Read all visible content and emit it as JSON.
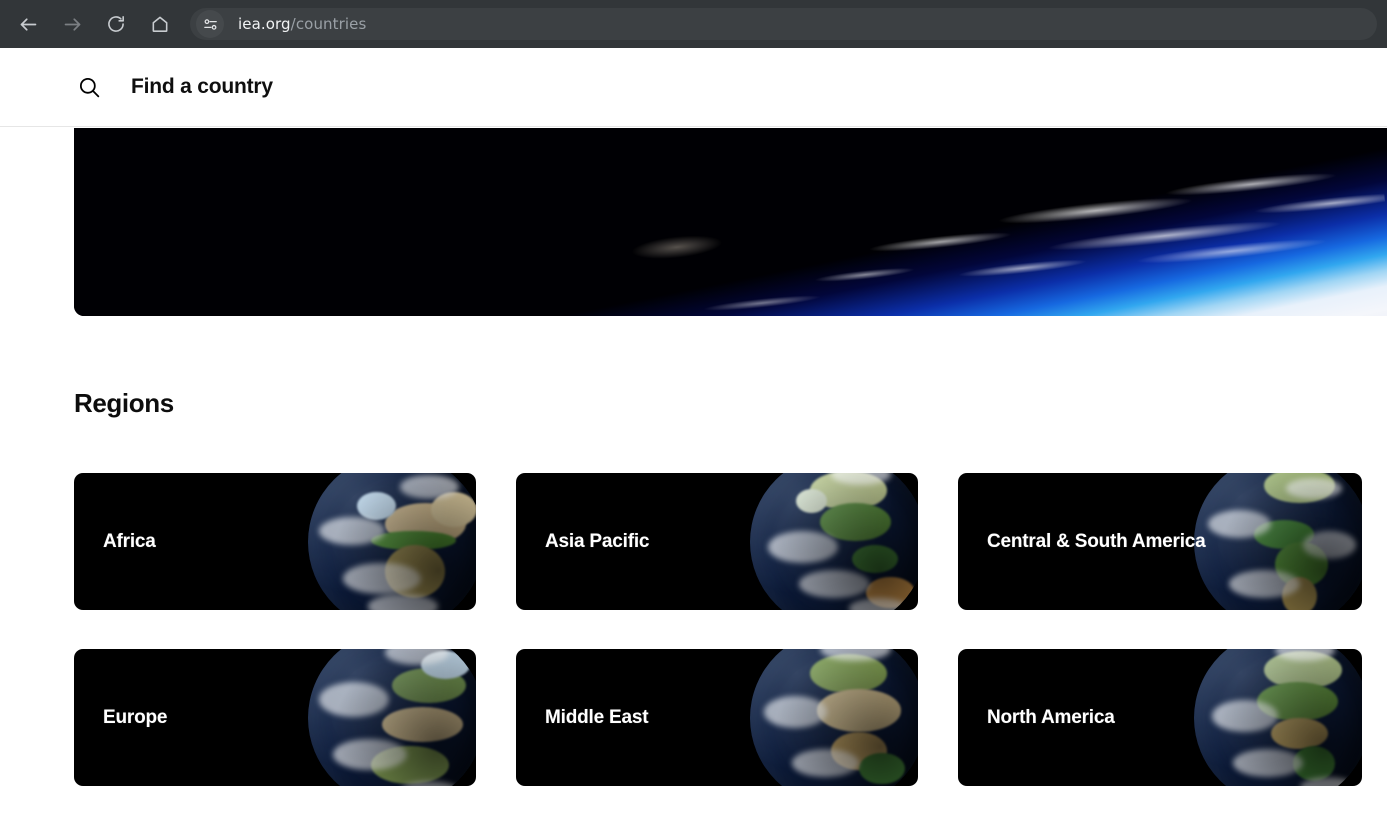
{
  "browser": {
    "back_icon": "arrow-left-icon",
    "forward_icon": "arrow-right-icon",
    "reload_icon": "reload-icon",
    "home_icon": "home-icon",
    "site_settings_icon": "tune-sliders-icon",
    "url_host": "iea.org",
    "url_path": "/countries",
    "chrome_bg": "#323639",
    "omnibox_bg": "#3c4043"
  },
  "search": {
    "icon": "search-icon",
    "label": "Find a country",
    "placeholder": "Find a country"
  },
  "hero": {
    "alt": "Earth horizon seen from space",
    "image_name": "earth-limb-banner"
  },
  "main": {
    "section_title": "Regions",
    "regions": [
      {
        "label": "Africa",
        "globe": "globe-africa-icon"
      },
      {
        "label": "Asia Pacific",
        "globe": "globe-asia-icon"
      },
      {
        "label": "Central & South America",
        "globe": "globe-south-america-icon"
      },
      {
        "label": "Europe",
        "globe": "globe-europe-icon"
      },
      {
        "label": "Middle East",
        "globe": "globe-middle-east-icon"
      },
      {
        "label": "North America",
        "globe": "globe-north-america-icon"
      }
    ]
  },
  "colors": {
    "page_bg": "#ffffff",
    "card_bg": "#000000",
    "text_primary": "#0f0f0f",
    "card_text": "#ffffff",
    "divider": "#e6e6e6"
  }
}
